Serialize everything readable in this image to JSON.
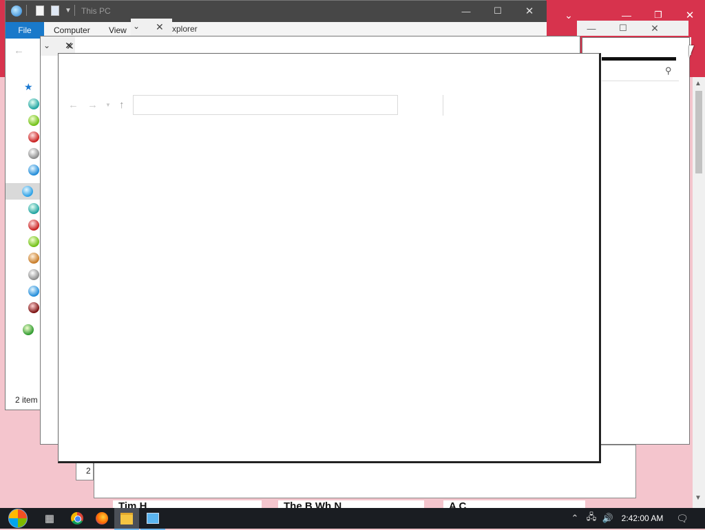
{
  "explorer": {
    "title": "This PC",
    "ribbon_tabs": [
      "File",
      "Computer",
      "View"
    ],
    "status": "2 item",
    "tab_partial": "xplorer"
  },
  "front_window": {
    "address_value": ""
  },
  "bottom_cards": [
    "Tim H",
    "The B    Wh  N",
    "A C"
  ],
  "taskbar": {
    "clock": "2:42:00 AM"
  },
  "colors": {
    "desktop_red": "#d7334d",
    "desktop_pink": "#f4c5cd",
    "taskbar": "#1a1d22",
    "file_tab_blue": "#1979ca"
  },
  "icons": {
    "nav_items": [
      "green-globe",
      "green-bomb",
      "red-bomb",
      "silver-bomb",
      "blue-bomb",
      "this-pc",
      "green-bomb",
      "red-bomb",
      "lime-bomb",
      "orange-bomb",
      "silver-bomb",
      "blue-bomb",
      "dark-red-bomb",
      "network"
    ]
  }
}
